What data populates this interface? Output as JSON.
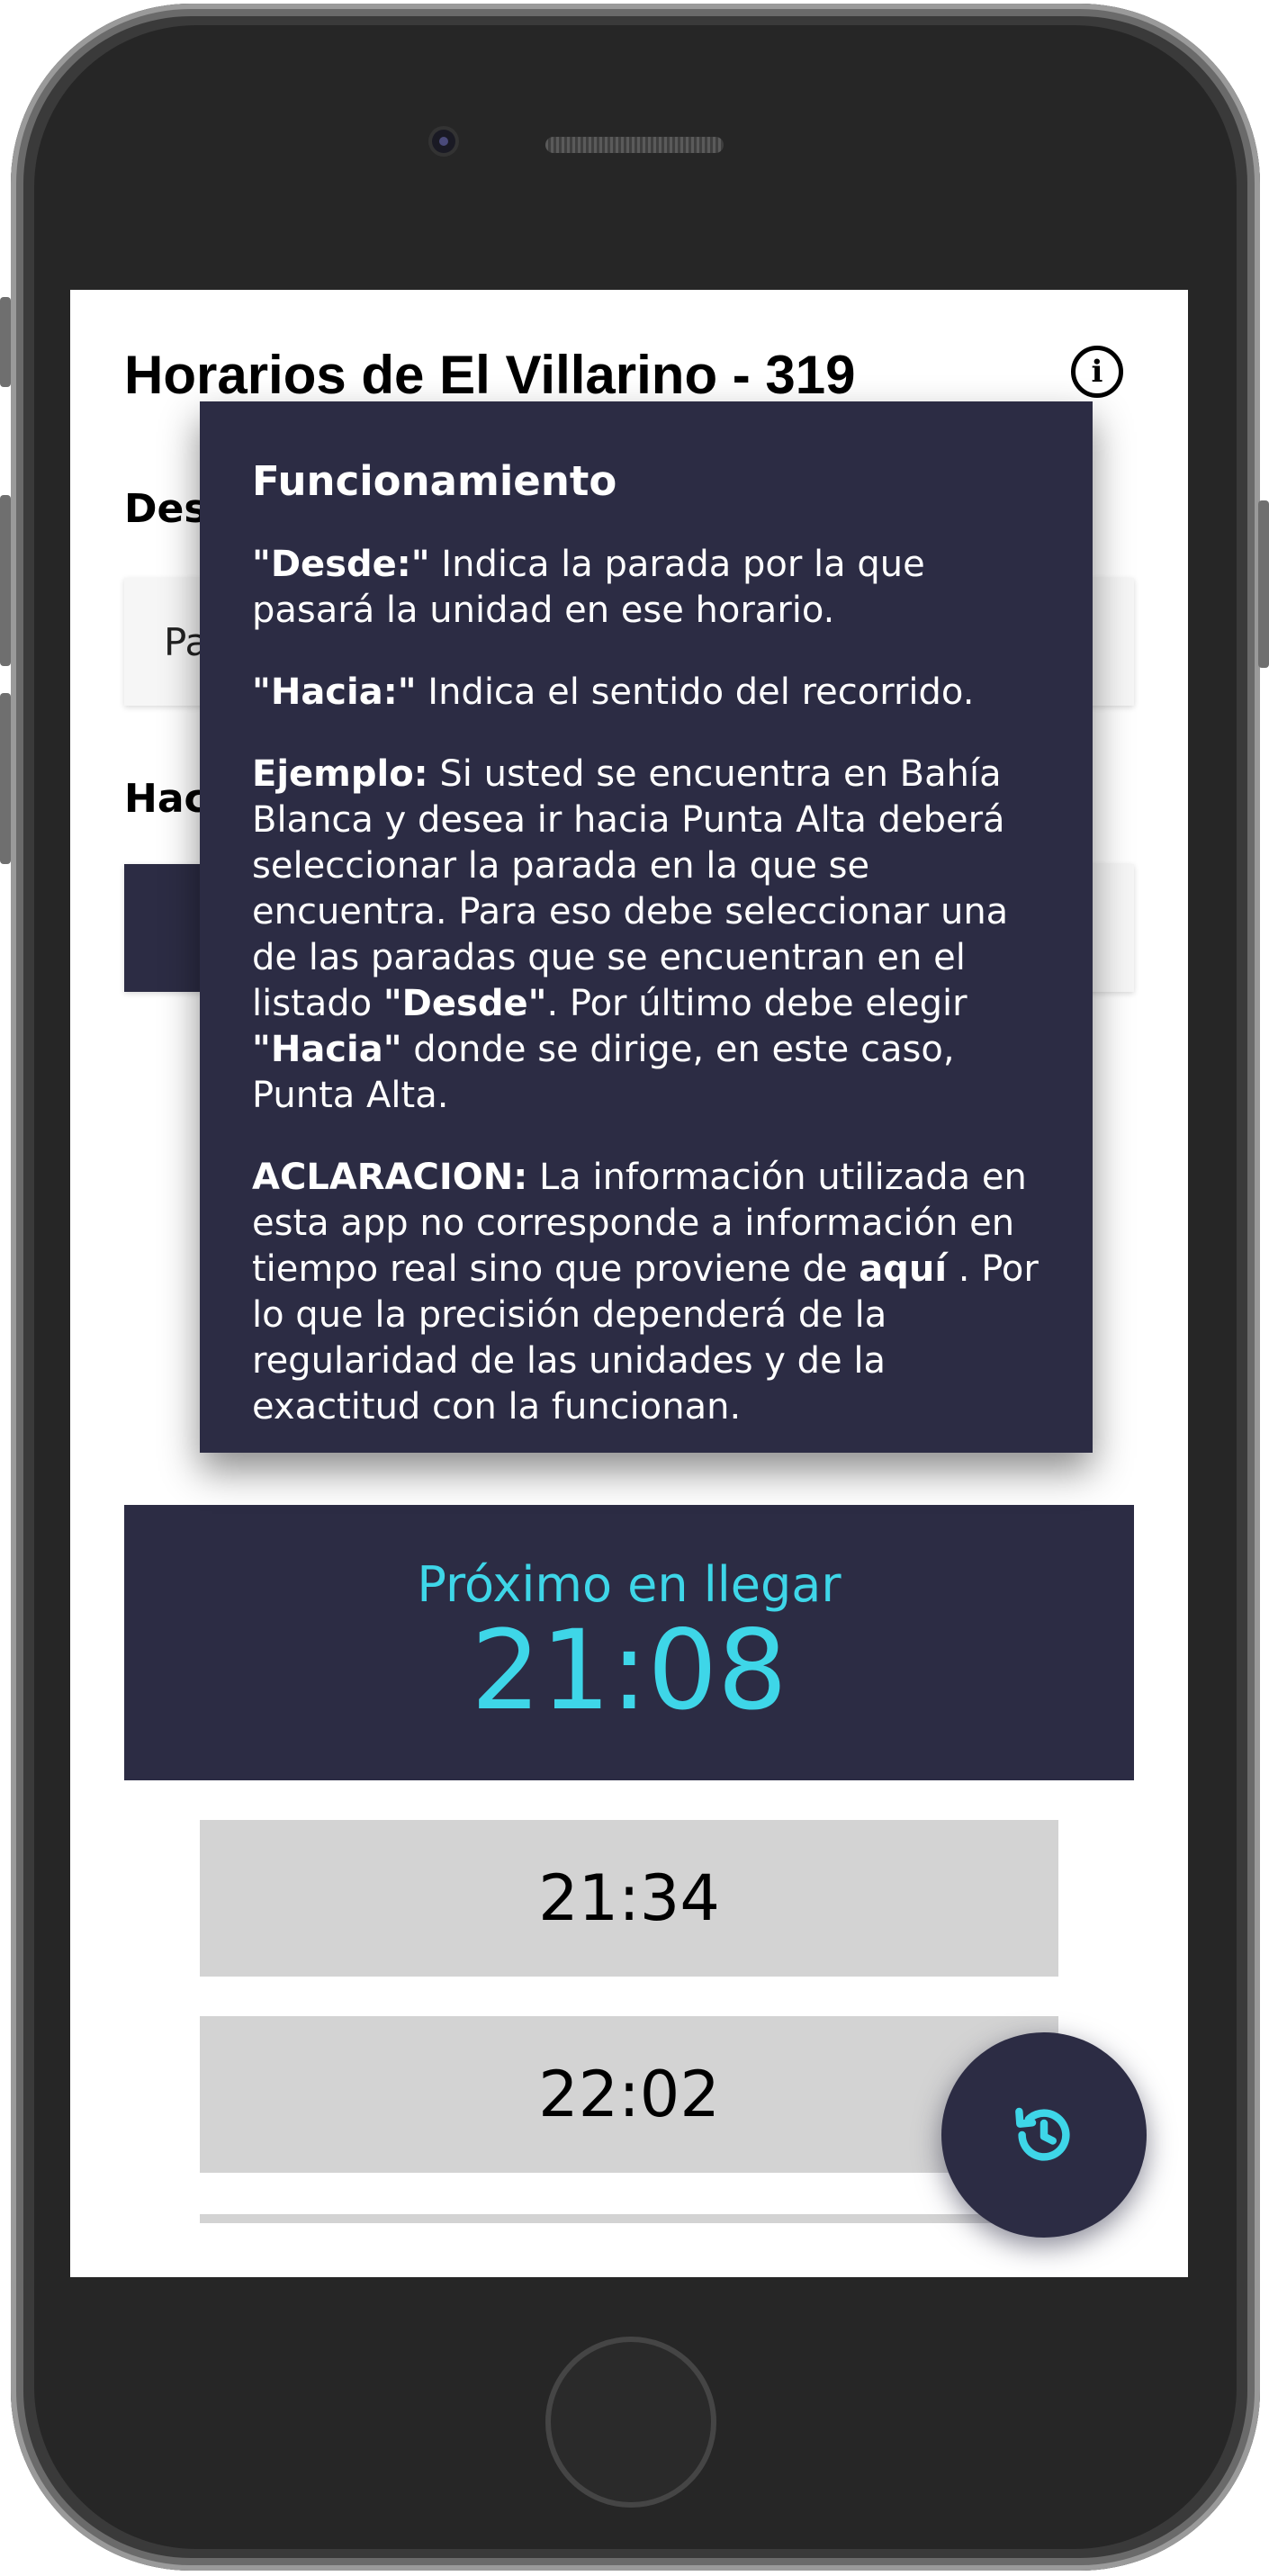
{
  "header": {
    "title": "Horarios de El Villarino - 319",
    "info_icon": "info-icon"
  },
  "form": {
    "desde_label": "Desde",
    "desde_value": "Pa",
    "hacia_label": "Hacia"
  },
  "modal": {
    "title": "Funcionamiento",
    "p1_bold": "\"Desde:\"",
    "p1_text": " Indica la parada por la que pasará la unidad en ese horario.",
    "p2_bold": "\"Hacia:\"",
    "p2_text": " Indica el sentido del recorrido.",
    "p3_bold": "Ejemplo:",
    "p3_text": " Si usted se encuentra en Bahía Blanca y desea ir hacia Punta Alta deberá seleccionar la parada en la que se encuentra. Para eso debe seleccionar una de las paradas que se encuentran en el listado ",
    "p3_bold2": "\"Desde\"",
    "p3_text2": ". Por último debe elegir ",
    "p3_bold3": "\"Hacia\"",
    "p3_text3": " donde se dirige, en este caso, Punta Alta.",
    "p4_bold": "ACLARACION:",
    "p4_text": " La información utilizada en esta app no corresponde a información en tiempo real sino que proviene de ",
    "p4_link": "aquí",
    "p4_text2": " . Por lo que la precisión dependerá de la regularidad de las unidades y de la exactitud con la funcionan."
  },
  "next_arrival": {
    "label": "Próximo en llegar",
    "time": "21:08"
  },
  "schedule": {
    "times": [
      "21:34",
      "22:02"
    ]
  },
  "fab": {
    "icon": "history-icon"
  },
  "colors": {
    "primary_dark": "#2c2c44",
    "accent_cyan": "#3ed6e8",
    "row_gray": "#d3d3d3"
  }
}
